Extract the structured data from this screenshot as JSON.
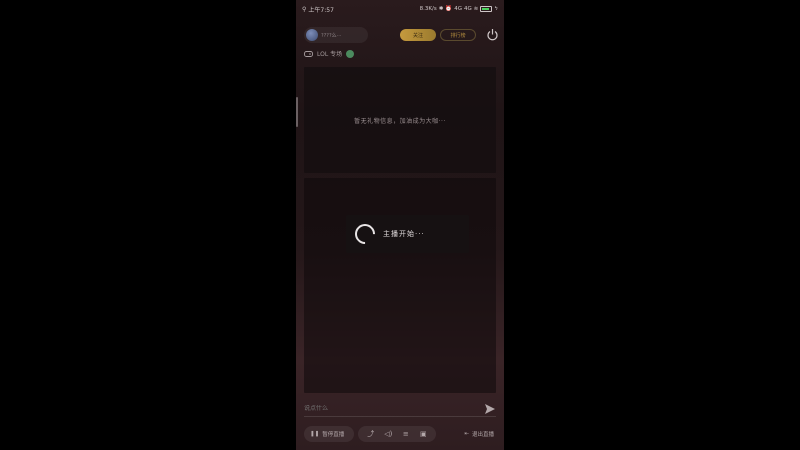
{
  "status_bar": {
    "time": "上午7:57",
    "net_speed": "8.3K/s",
    "signal_1": "4G",
    "signal_2": "4G"
  },
  "header": {
    "profile_name": "????么···",
    "gold_button": "关注",
    "outline_button": "排行榜"
  },
  "room": {
    "label": "LOL 专场"
  },
  "panel_top": {
    "message": "暂无礼物信息，加油成为大咖···"
  },
  "loading": {
    "text": "主播开始···"
  },
  "input": {
    "placeholder": "说点什么"
  },
  "toolbar": {
    "pause_label": "暂停直播",
    "exit_label": "退出直播"
  },
  "colors": {
    "accent_gold": "#c59a3e",
    "background": "#231618"
  }
}
